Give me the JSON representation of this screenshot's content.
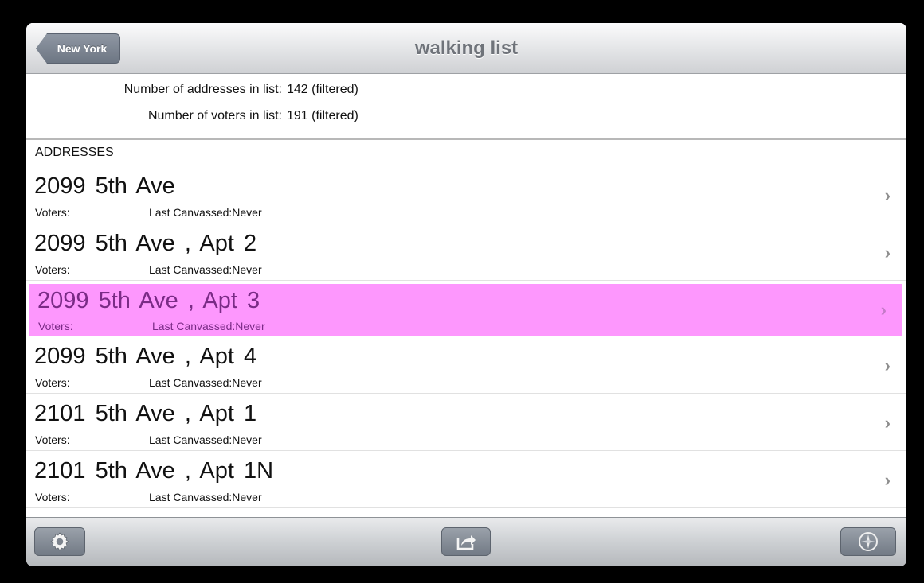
{
  "nav": {
    "back_label": "New York",
    "title": "walking list"
  },
  "summary": {
    "addresses_label": "Number of addresses in list:",
    "addresses_value": "142 (filtered)",
    "voters_label": "Number of voters in list:",
    "voters_value": "191 (filtered)"
  },
  "section_header": "ADDRESSES",
  "addresses": [
    {
      "address": "2099  5th Ave",
      "voters_label": "Voters:",
      "canvassed": "Last Canvassed:Never",
      "selected": false
    },
    {
      "address": "2099  5th Ave , Apt 2",
      "voters_label": "Voters:",
      "canvassed": "Last Canvassed:Never",
      "selected": false
    },
    {
      "address": "2099  5th Ave , Apt 3",
      "voters_label": "Voters:",
      "canvassed": "Last Canvassed:Never",
      "selected": true
    },
    {
      "address": "2099  5th Ave , Apt 4",
      "voters_label": "Voters:",
      "canvassed": "Last Canvassed:Never",
      "selected": false
    },
    {
      "address": "2101  5th Ave , Apt 1",
      "voters_label": "Voters:",
      "canvassed": "Last Canvassed:Never",
      "selected": false
    },
    {
      "address": "2101  5th Ave , Apt 1N",
      "voters_label": "Voters:",
      "canvassed": "Last Canvassed:Never",
      "selected": false
    }
  ],
  "toolbar": {
    "left_icon": "gear-icon",
    "center_icon": "share-icon",
    "right_icon": "compass-icon"
  },
  "colors": {
    "selected_row": "#fd97fd",
    "selected_text": "#7a2b86"
  }
}
